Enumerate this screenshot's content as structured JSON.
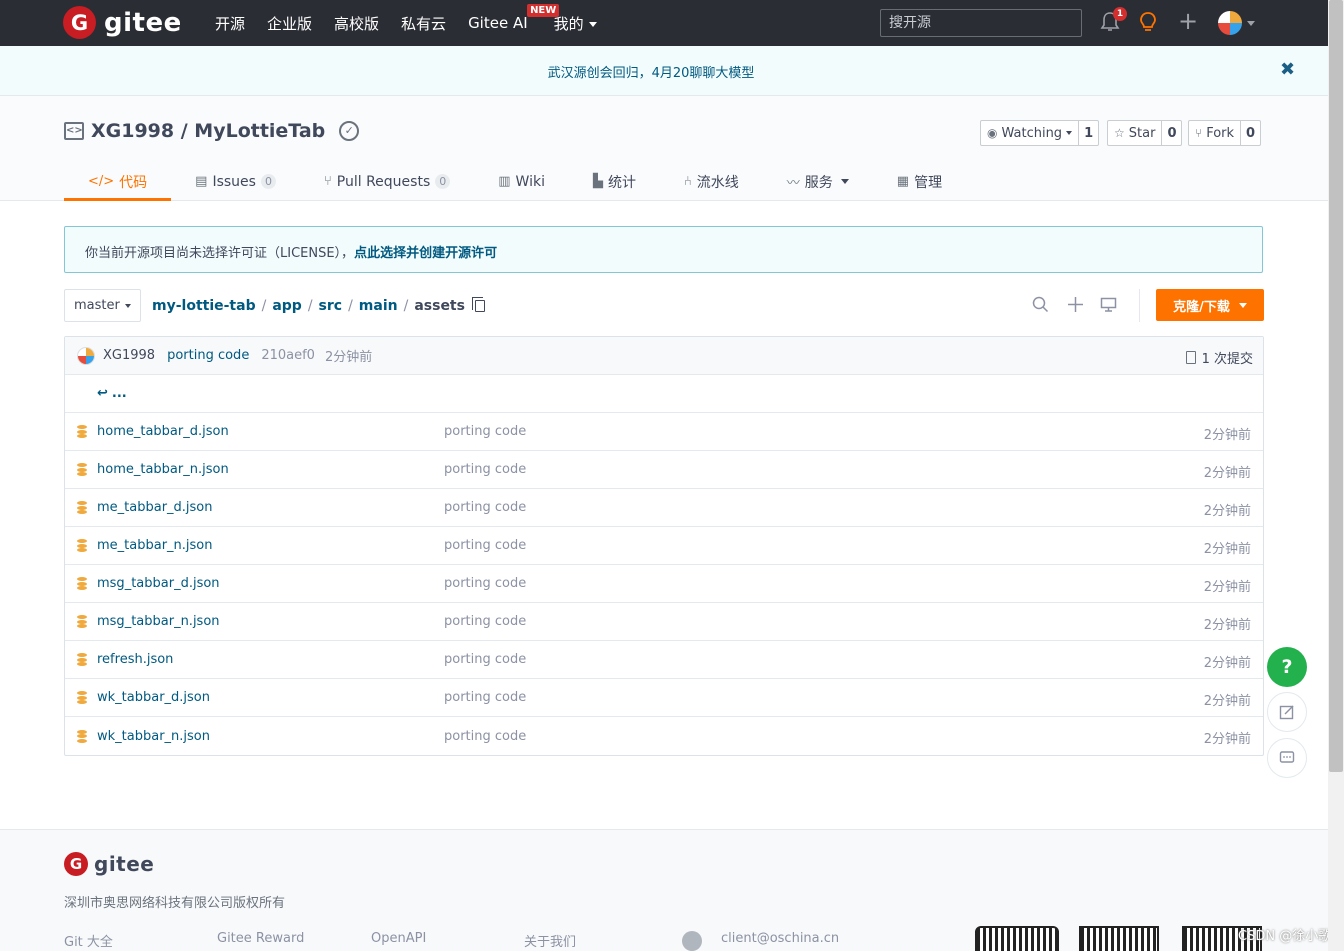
{
  "brand": {
    "logo_letter": "G",
    "name": "gitee"
  },
  "nav": {
    "links": [
      "开源",
      "企业版",
      "高校版",
      "私有云",
      "Gitee AI",
      "我的"
    ],
    "new_badge": "NEW",
    "search_placeholder": "搜开源",
    "notification_count": "1",
    "plus": "+"
  },
  "announcement": {
    "text": "武汉源创会回归，4月20聊聊大模型",
    "close": "✖"
  },
  "repo": {
    "full_name": "XG1998 / MyLottieTab",
    "watch_label": "Watching",
    "watch_count": "1",
    "star_label": "Star",
    "star_count": "0",
    "fork_label": "Fork",
    "fork_count": "0"
  },
  "tabs": [
    {
      "label": "代码"
    },
    {
      "label": "Issues",
      "count": "0"
    },
    {
      "label": "Pull Requests",
      "count": "0"
    },
    {
      "label": "Wiki"
    },
    {
      "label": "统计"
    },
    {
      "label": "流水线"
    },
    {
      "label": "服务"
    },
    {
      "label": "管理"
    }
  ],
  "license": {
    "text": "你当前开源项目尚未选择许可证（LICENSE），",
    "link": "点此选择并创建开源许可"
  },
  "branch": "master",
  "breadcrumb": [
    "my-lottie-tab",
    "app",
    "src",
    "main",
    "assets"
  ],
  "clone_button": "克隆/下载",
  "commit": {
    "author": "XG1998",
    "message": "porting code",
    "sha": "210aef0",
    "time": "2分钟前",
    "count": "1 次提交"
  },
  "up_dir": "...",
  "files": [
    {
      "name": "home_tabbar_d.json",
      "message": "porting code",
      "time": "2分钟前"
    },
    {
      "name": "home_tabbar_n.json",
      "message": "porting code",
      "time": "2分钟前"
    },
    {
      "name": "me_tabbar_d.json",
      "message": "porting code",
      "time": "2分钟前"
    },
    {
      "name": "me_tabbar_n.json",
      "message": "porting code",
      "time": "2分钟前"
    },
    {
      "name": "msg_tabbar_d.json",
      "message": "porting code",
      "time": "2分钟前"
    },
    {
      "name": "msg_tabbar_n.json",
      "message": "porting code",
      "time": "2分钟前"
    },
    {
      "name": "refresh.json",
      "message": "porting code",
      "time": "2分钟前"
    },
    {
      "name": "wk_tabbar_d.json",
      "message": "porting code",
      "time": "2分钟前"
    },
    {
      "name": "wk_tabbar_n.json",
      "message": "porting code",
      "time": "2分钟前"
    }
  ],
  "float": {
    "help": "?"
  },
  "footer": {
    "company": "深圳市奥思网络科技有限公司版权所有",
    "links": [
      "Git 大全",
      "Gitee Reward",
      "OpenAPI",
      "关于我们"
    ],
    "email": "client@oschina.cn",
    "watermark": "CSDN @徐小歌"
  },
  "colors": {
    "accent": "#fe7300",
    "nav_bg": "#2a2d34",
    "link": "#005980",
    "brand_red": "#c71d23",
    "help_green": "#22b14c"
  }
}
